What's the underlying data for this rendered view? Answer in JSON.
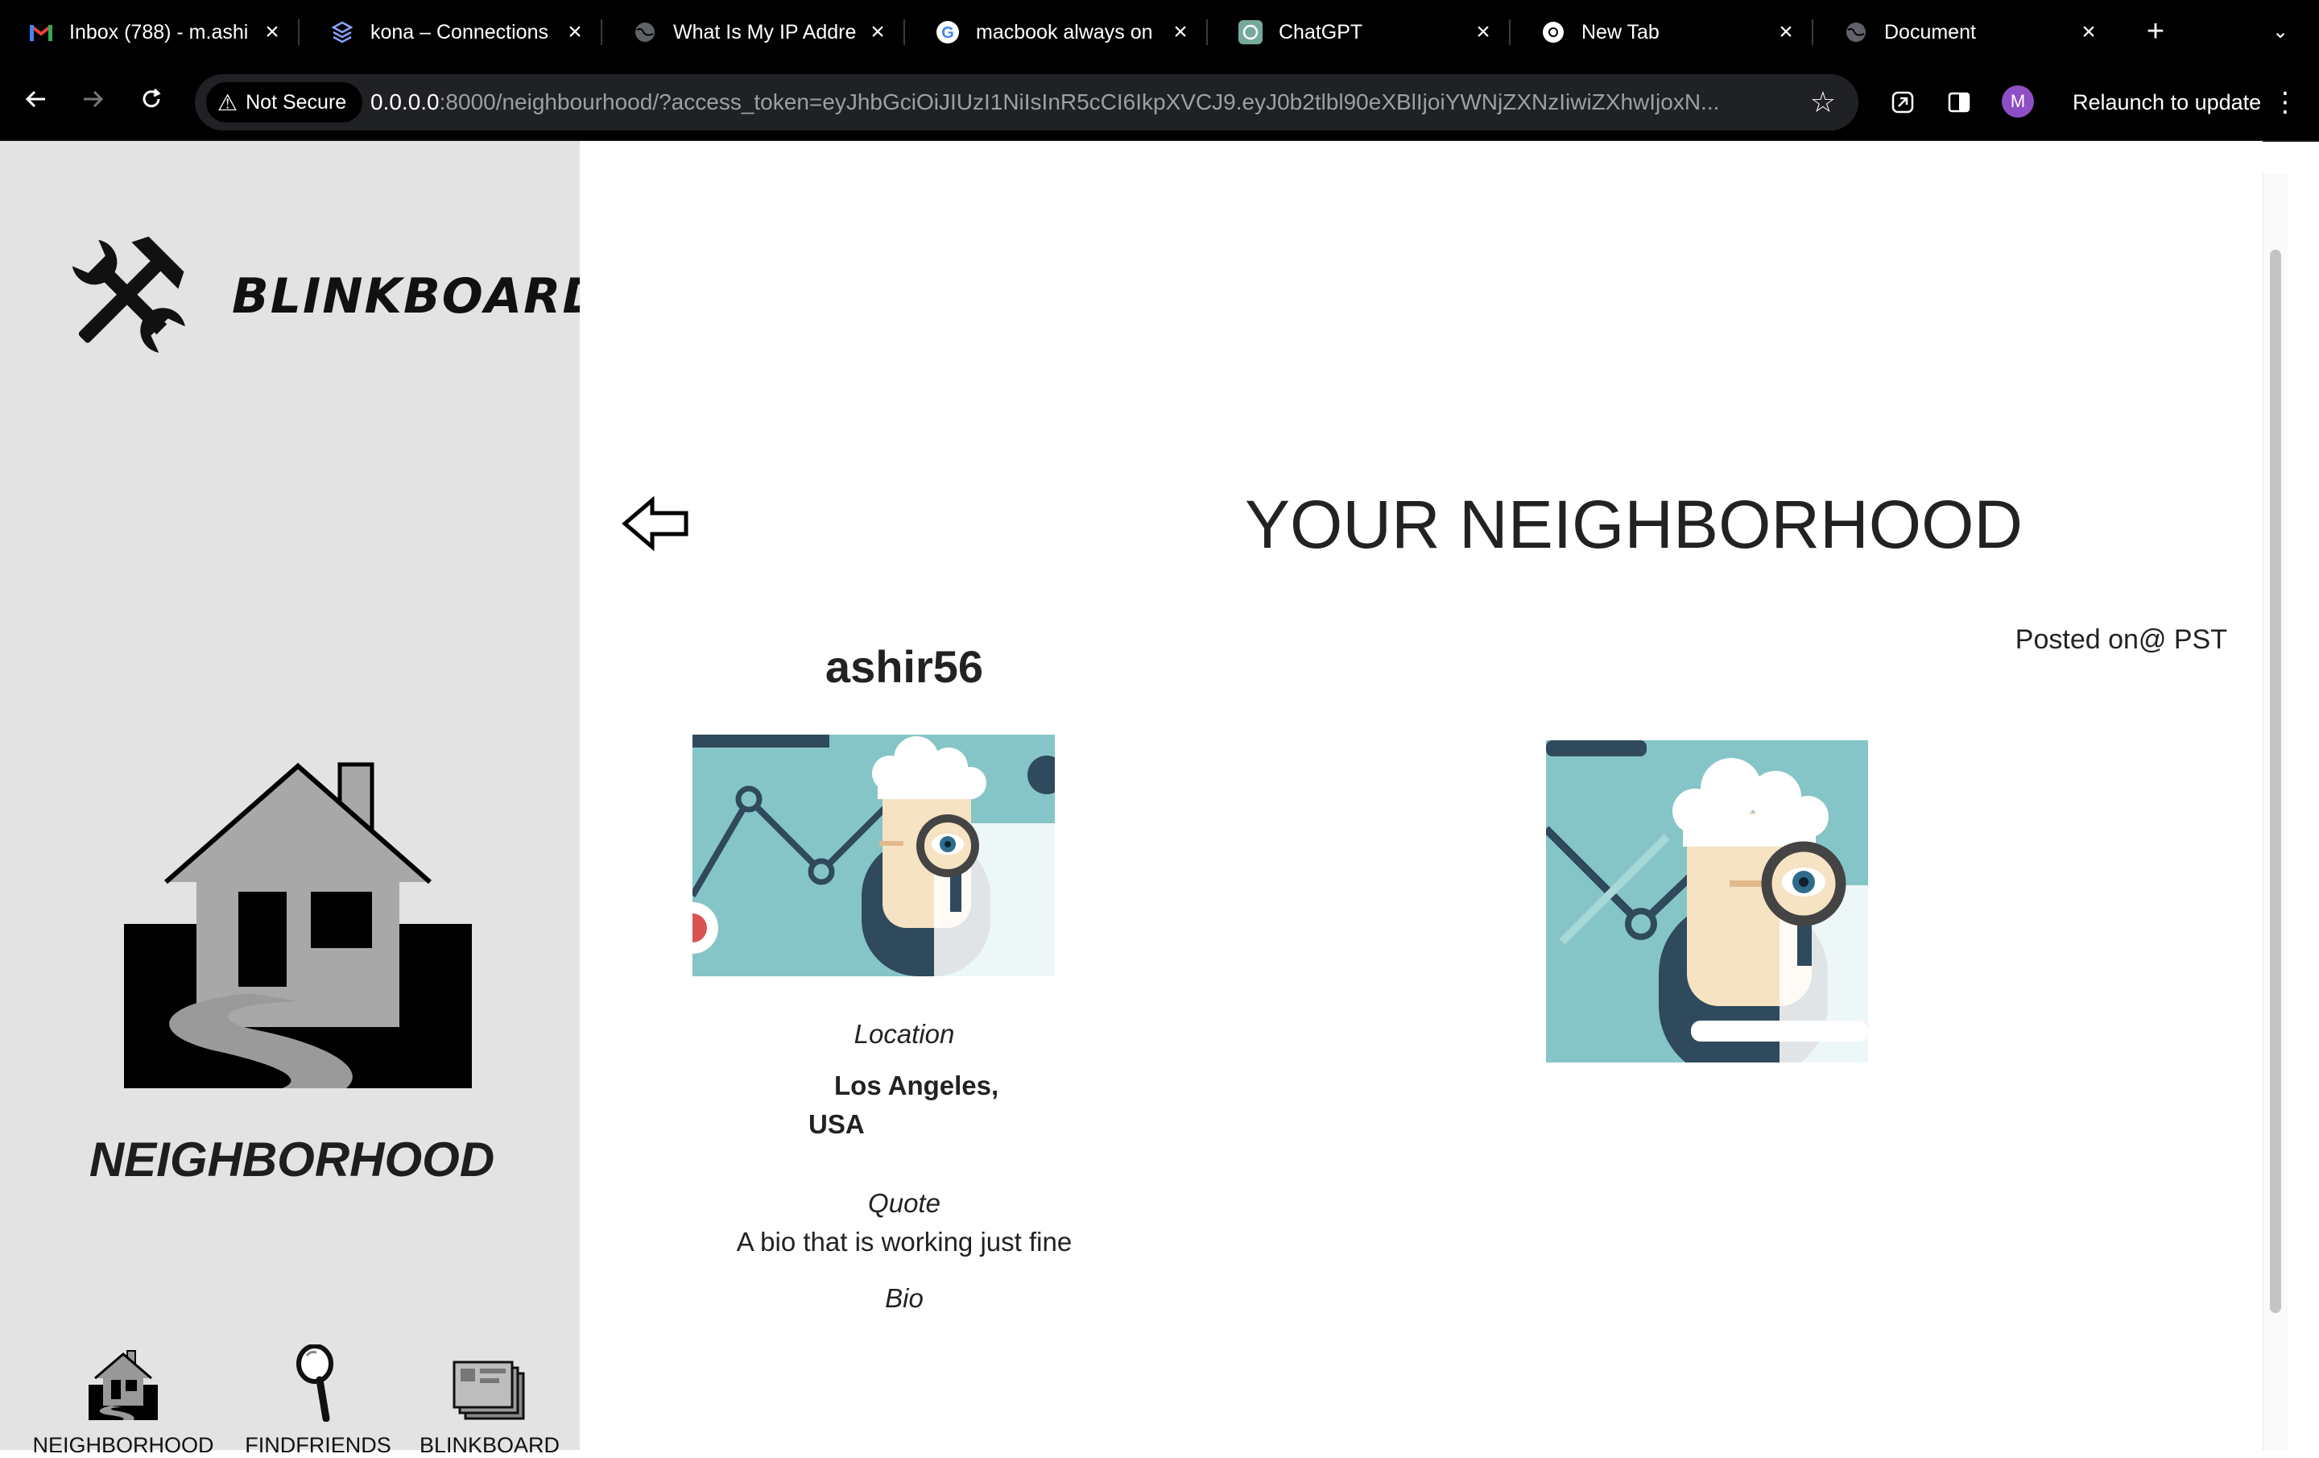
{
  "browser": {
    "tabs": [
      {
        "title": "Inbox (788) - m.ashi",
        "icon": "gmail-icon"
      },
      {
        "title": "kona – Connections",
        "icon": "stack-icon"
      },
      {
        "title": "What Is My IP Addre",
        "icon": "globe-icon"
      },
      {
        "title": "macbook always on",
        "icon": "google-icon"
      },
      {
        "title": "ChatGPT",
        "icon": "chatgpt-icon"
      },
      {
        "title": "New Tab",
        "icon": "chrome-icon"
      },
      {
        "title": "Document",
        "icon": "globe-icon"
      }
    ],
    "security_label": "Not Secure",
    "url_host": "0.0.0.0",
    "url_rest": ":8000/neighbourhood/?access_token=eyJhbGciOiJIUzI1NiIsInR5cCI6IkpXVCJ9.eyJ0b2tlbl90eXBlIjoiYWNjZXNzIiwiZXhwIjoxN...",
    "avatar_letter": "M",
    "relaunch_label": "Relaunch to update"
  },
  "sidebar": {
    "brand": "BLINKBOARD",
    "hero_title": "NEIGHBORHOOD",
    "nav": [
      {
        "label": "NEIGHBORHOOD",
        "icon": "neighborhood-icon"
      },
      {
        "label": "FINDFRIENDS",
        "icon": "magnifier-icon"
      },
      {
        "label": "BLINKBOARD",
        "icon": "stacked-boards-icon"
      }
    ]
  },
  "main": {
    "title": "YOUR NEIGHBORHOOD",
    "posted": "Posted on@ PST",
    "profile": {
      "username": "ashir56",
      "location_label": "Location",
      "location_line1": "Los Angeles,",
      "location_line2": "USA",
      "quote_label": "Quote",
      "quote_value": "A bio that is working just fine",
      "bio_label": "Bio"
    }
  },
  "colors": {
    "sidebar_bg": "#e3e3e3",
    "illustration_teal": "#86c5c7",
    "illustration_navy": "#2f4a5c",
    "browser_chrome": "#000000"
  }
}
